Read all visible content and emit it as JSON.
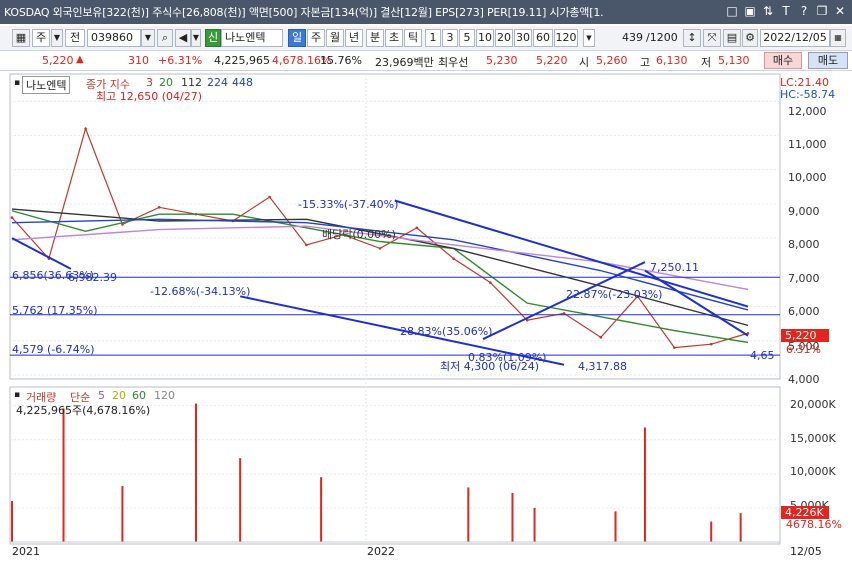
{
  "titlebar": {
    "title": "KOSDAQ 외국인보유[322(천)] 주식수[26,808(천)] 액면[500] 자본금[134(억)] 결산[12월] EPS[273] PER[19.11] 시가총액[1.",
    "icons": [
      "window-icon",
      "layout-icon",
      "sort-icon",
      "text-icon",
      "help-icon",
      "restore-icon",
      "close-icon"
    ]
  },
  "toolbar": {
    "market_select": "주",
    "prev_label": "전",
    "code_value": "039860",
    "stock_name_badge": "신",
    "stock_name": "나노엔텍",
    "periods": [
      "일",
      "주",
      "월",
      "년",
      "분",
      "초",
      "틱"
    ],
    "intervals": [
      "1",
      "3",
      "5",
      "10",
      "20",
      "30",
      "60",
      "120"
    ],
    "count_value": "439",
    "count_total": "/1200",
    "date_value": "2022/12/05"
  },
  "quote": {
    "price": "5,220",
    "change": "310",
    "change_pct": "+6.31%",
    "volume": "4,225,965",
    "volume2": "4,678.16%",
    "turnover": "15.76%",
    "amount": "23,969백만",
    "preferred_label": "최우선",
    "preferred_1": "5,230",
    "preferred_2": "5,220",
    "open_label": "시",
    "open": "5,260",
    "high_label": "고",
    "high": "6,130",
    "low_label": "저",
    "low": "5,130",
    "buy_label": "매수",
    "sell_label": "매도"
  },
  "chart_data": [
    {
      "type": "line",
      "title": "나노엔텍",
      "legend": [
        "종가 지수",
        "3",
        "20",
        "112",
        "224",
        "448"
      ],
      "corner_labels": [
        "LC:21.40",
        "HC:-58.74"
      ],
      "ylim": [
        4000,
        12650
      ],
      "y_ticks": [
        4000,
        5000,
        6000,
        7000,
        8000,
        9000,
        10000,
        11000,
        12000
      ],
      "y_tick_labels": [
        "4,000",
        "5,000",
        "6,000",
        "7,000",
        "8,000",
        "9,000",
        "10,000",
        "11,000",
        "12,000"
      ],
      "x_labels": [
        "2021",
        "2022",
        "12/05"
      ],
      "series": [
        {
          "name": "종가",
          "x": [
            0,
            5,
            10,
            15,
            20,
            25,
            30,
            35,
            40,
            45,
            50,
            55,
            60,
            65,
            70,
            75,
            80,
            85,
            90,
            95,
            100
          ],
          "values": [
            8600,
            7400,
            11200,
            8400,
            8900,
            8700,
            8500,
            9200,
            7800,
            8100,
            7700,
            8300,
            7400,
            6700,
            5600,
            5800,
            5100,
            6300,
            4800,
            4900,
            5220
          ]
        },
        {
          "name": "20",
          "x": [
            0,
            10,
            20,
            30,
            40,
            50,
            60,
            70,
            80,
            90,
            100
          ],
          "values": [
            8800,
            8200,
            8700,
            8700,
            8300,
            7900,
            7700,
            6100,
            5700,
            5300,
            4950
          ]
        },
        {
          "name": "112",
          "x": [
            0,
            20,
            40,
            60,
            80,
            100
          ],
          "values": [
            8850,
            8500,
            8550,
            7700,
            6600,
            5450
          ]
        },
        {
          "name": "224",
          "x": [
            0,
            20,
            40,
            60,
            80,
            100
          ],
          "values": [
            8450,
            8550,
            8450,
            7950,
            7050,
            5900
          ]
        },
        {
          "name": "448",
          "x": [
            0,
            20,
            40,
            60,
            80,
            100
          ],
          "values": [
            7950,
            8250,
            8350,
            7800,
            7300,
            6500
          ]
        }
      ],
      "annotations": [
        "최고 12,650 (04/27)",
        "최저 4,300 (06/24)",
        "4,317.88",
        "-15.33%(-37.40%)",
        "배당락(0.00%)",
        "7,250.11",
        "22.87%(-23.03%)",
        "28.83%(35.06%)",
        "-12.68%(-34.13%)",
        "0.83%(1.09%)",
        "6,856(36.63%)",
        "6,982.39",
        "5,762 (17.35%)",
        "4,579 (-6.74%)",
        "5,220",
        "6.31%",
        "4,65"
      ]
    },
    {
      "type": "bar",
      "title": "거래량",
      "legend": [
        "거래량",
        "단순",
        "5",
        "20",
        "60",
        "120"
      ],
      "value_label": "4,225,965주(4,678.16%)",
      "ylim": [
        0,
        22000000
      ],
      "y_tick_labels": [
        "5,000K",
        "10,000K",
        "15,000K",
        "20,000K"
      ],
      "last_value_labels": [
        "4,226K",
        "4678.16%"
      ],
      "x": [
        0,
        7,
        15,
        25,
        31,
        42,
        62,
        68,
        71,
        82,
        86,
        95,
        99
      ],
      "values": [
        6000000,
        19600000,
        8200000,
        20300000,
        12300000,
        9500000,
        8000000,
        7200000,
        5000000,
        4500000,
        16800000,
        3000000,
        4226000
      ]
    }
  ],
  "colors": {
    "titlebar": "#4a5669",
    "price_line": "#c0392b",
    "ma20": "#2e8b2e",
    "ma112": "#333333",
    "ma224": "#2244cc",
    "ma448": "#c084d8",
    "trendline": "#1f2fd1",
    "up": "#e0261f",
    "down": "#1f4fd1"
  }
}
